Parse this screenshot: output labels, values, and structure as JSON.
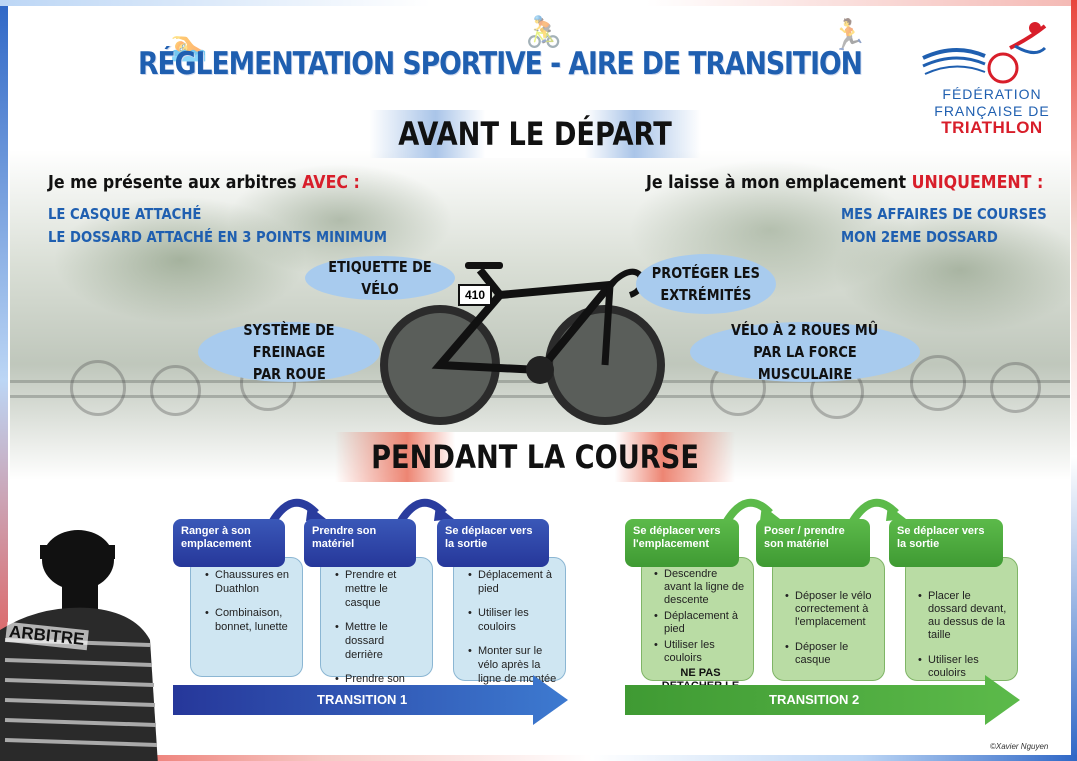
{
  "title": "RÉGLEMENTATION SPORTIVE - AIRE DE TRANSITION",
  "logo": {
    "line1": "FÉDÉRATION",
    "line2": "FRANÇAISE DE",
    "line3": "TRIATHLON"
  },
  "avant": {
    "heading": "AVANT LE DÉPART",
    "left_intro": "Je me présente aux arbitres ",
    "left_intro_red": "AVEC :",
    "left_items": [
      "LE CASQUE ATTACHÉ",
      "LE DOSSARD ATTACHÉ EN 3 POINTS MINIMUM"
    ],
    "right_intro": "Je laisse à mon emplacement ",
    "right_intro_red": "UNIQUEMENT :",
    "right_items": [
      "MES AFFAIRES DE COURSES",
      "MON 2EME DOSSARD"
    ],
    "bubbles": {
      "etiquette": "ETIQUETTE DE VÉLO",
      "freinage_1": "SYSTÈME DE FREINAGE",
      "freinage_2": "PAR ROUE",
      "proteger_1": "PROTÉGER LES",
      "proteger_2": "EXTRÉMITÉS",
      "velo_1": "VÉLO À 2 ROUES MÛ",
      "velo_2": "PAR LA FORCE MUSCULAIRE"
    },
    "bike_tag": "410"
  },
  "pendant": {
    "heading": "PENDANT LA COURSE",
    "t1": {
      "label": "TRANSITION 1",
      "steps": [
        {
          "title": "Ranger à son emplacement",
          "items": [
            "Chaussures en Duathlon",
            "Combinaison, bonnet, lunette"
          ]
        },
        {
          "title": "Prendre son matériel",
          "items": [
            "Prendre et mettre le casque",
            "Mettre le dossard derrière",
            "Prendre son vélo"
          ]
        },
        {
          "title": "Se déplacer vers la sortie",
          "items": [
            "Déplacement à pied",
            "Utiliser les couloirs",
            "Monter sur le vélo après la ligne de montée"
          ]
        }
      ]
    },
    "t2": {
      "label": "TRANSITION 2",
      "steps": [
        {
          "title": "Se déplacer vers l'emplacement",
          "items": [
            "Descendre avant la ligne de descente",
            "Déplacement à pied",
            "Utiliser les couloirs"
          ],
          "note": "NE PAS DETACHER LE CASQUE"
        },
        {
          "title": "Poser / prendre son matériel",
          "items": [
            "Déposer le vélo correctement à l'emplacement",
            "Déposer le casque"
          ]
        },
        {
          "title": "Se déplacer vers la sortie",
          "items": [
            "Placer le dossard devant, au dessus de la taille",
            "Utiliser les couloirs"
          ]
        }
      ]
    }
  },
  "referee_label": "ARBITRE",
  "credit": "©Xavier Nguyen",
  "colors": {
    "blue": "#1f5fb0",
    "red": "#d81e2a",
    "t1": "#2a3c9e",
    "t2": "#4aaa3c"
  }
}
